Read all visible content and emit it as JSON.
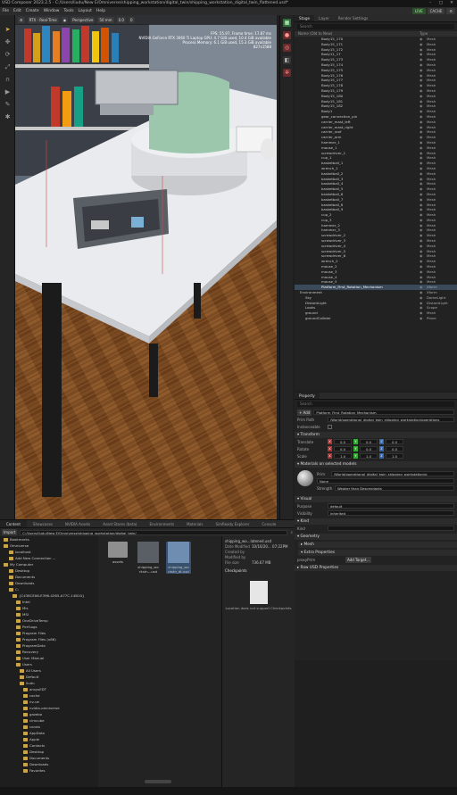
{
  "titlebar": {
    "app": "USD Composer",
    "version": "2023.2.5",
    "path": "C:/Users/liudu/New E/Omniverse/shipping_workstation/digital_twin/shipping_workstation_digital_twin_flattened.usd*"
  },
  "menu": [
    "File",
    "Edit",
    "Create",
    "Window",
    "Tools",
    "Layout",
    "Help"
  ],
  "menu_right": {
    "live": "LIVE",
    "cache": "CACHE"
  },
  "viewport": {
    "render_mode": "RTX - Real-Time",
    "camera": "Perspective",
    "lens": "50 mm",
    "speed": "0.0",
    "lights": "0",
    "stats": [
      "FPS: 55.97, Frame time: 17.87 ms",
      "NVIDIA GeForce RTX 3060 Ti Laptop GPU: 4.7 GiB used, 10.4 GiB available",
      "Process Memory: 6.1 GiB used, 15.3 GiB available",
      "827x1588"
    ]
  },
  "stage": {
    "tabs": [
      "Stage",
      "Layer",
      "Render Settings"
    ],
    "search_placeholder": "Search",
    "col_name": "Name (Old to New)",
    "col_type": "Type",
    "rows": [
      {
        "name": "Body15_170",
        "type": "Mesh"
      },
      {
        "name": "Body15_171",
        "type": "Mesh"
      },
      {
        "name": "Body15_172",
        "type": "Mesh"
      },
      {
        "name": "Body11_17",
        "type": "Mesh"
      },
      {
        "name": "Body15_173",
        "type": "Mesh"
      },
      {
        "name": "Body15_174",
        "type": "Mesh"
      },
      {
        "name": "Body15_175",
        "type": "Mesh"
      },
      {
        "name": "Body15_176",
        "type": "Mesh"
      },
      {
        "name": "Body15_177",
        "type": "Mesh"
      },
      {
        "name": "Body15_178",
        "type": "Mesh"
      },
      {
        "name": "Body15_179",
        "type": "Mesh"
      },
      {
        "name": "Body15_180",
        "type": "Mesh"
      },
      {
        "name": "Body15_181",
        "type": "Mesh"
      },
      {
        "name": "Body15_182",
        "type": "Mesh"
      },
      {
        "name": "Body1",
        "type": "Mesh"
      },
      {
        "name": "gear_connection_pin",
        "type": "Mesh"
      },
      {
        "name": "carrier_mast_left",
        "type": "Mesh"
      },
      {
        "name": "carrier_mast_right",
        "type": "Mesh"
      },
      {
        "name": "carrier_roof",
        "type": "Mesh"
      },
      {
        "name": "carrier_arm",
        "type": "Mesh"
      },
      {
        "name": "hammer_1",
        "type": "Mesh"
      },
      {
        "name": "mouse_1",
        "type": "Mesh"
      },
      {
        "name": "screwdriver_1",
        "type": "Mesh"
      },
      {
        "name": "cup_1",
        "type": "Mesh"
      },
      {
        "name": "basketball_1",
        "type": "Mesh"
      },
      {
        "name": "wrench_1",
        "type": "Mesh"
      },
      {
        "name": "basketball_2",
        "type": "Mesh"
      },
      {
        "name": "basketball_3",
        "type": "Mesh"
      },
      {
        "name": "basketball_4",
        "type": "Mesh"
      },
      {
        "name": "basketball_5",
        "type": "Mesh"
      },
      {
        "name": "basketball_6",
        "type": "Mesh"
      },
      {
        "name": "basketball_7",
        "type": "Mesh"
      },
      {
        "name": "basketball_8",
        "type": "Mesh"
      },
      {
        "name": "basketball_9",
        "type": "Mesh"
      },
      {
        "name": "cup_2",
        "type": "Mesh"
      },
      {
        "name": "cup_3",
        "type": "Mesh"
      },
      {
        "name": "hammer_2",
        "type": "Mesh"
      },
      {
        "name": "hammer_3",
        "type": "Mesh"
      },
      {
        "name": "screwdriver_2",
        "type": "Mesh"
      },
      {
        "name": "screwdriver_3",
        "type": "Mesh"
      },
      {
        "name": "screwdriver_4",
        "type": "Mesh"
      },
      {
        "name": "screwdriver_5",
        "type": "Mesh"
      },
      {
        "name": "screwdriver_6",
        "type": "Mesh"
      },
      {
        "name": "wrench_2",
        "type": "Mesh"
      },
      {
        "name": "mouse_2",
        "type": "Mesh"
      },
      {
        "name": "mouse_3",
        "type": "Mesh"
      },
      {
        "name": "mouse_4",
        "type": "Mesh"
      },
      {
        "name": "mouse_5",
        "type": "Mesh"
      },
      {
        "name": "Platform_First_Rotation_Mechanism",
        "type": "Xform",
        "selected": true
      },
      {
        "name": "Environment",
        "type": "Xform"
      },
      {
        "name": "Sky",
        "type": "DomeLight"
      },
      {
        "name": "DistantLight",
        "type": "DistantLight"
      },
      {
        "name": "Looks",
        "type": "Scope"
      },
      {
        "name": "ground",
        "type": "Mesh"
      },
      {
        "name": "groundCollider",
        "type": "Plane"
      }
    ]
  },
  "property": {
    "title": "Property",
    "search_placeholder": "Search",
    "add_label": "Add",
    "prim_name": "Platform_First_Rotation_Mechanism",
    "prim_path_label": "Prim Path",
    "prim_path": "/World/operational_digital_twin_shipping_workstation/operations",
    "instanceable_label": "Instanceable",
    "transform_label": "Transform",
    "translate_label": "Translate",
    "rotate_label": "Rotate",
    "scale_label": "Scale",
    "translate": [
      "0.0",
      "0.0",
      "0.0"
    ],
    "rotate": [
      "0.0",
      "0.0",
      "0.0"
    ],
    "scale": [
      "1.0",
      "1.0",
      "1.0"
    ],
    "materials_label": "Materials on selected models",
    "prim_label": "Prim",
    "material_path": "/World/operational_digital_twin_shipping_workstation/o",
    "material_value": "None",
    "strength_label": "Strength",
    "strength_value": "Weaker than Descendants",
    "visual_label": "Visual",
    "purpose_label": "Purpose",
    "purpose_value": "default",
    "visibility_label": "Visibility",
    "visibility_value": "inherited",
    "kind_label": "Kind",
    "kind_field_label": "Kind",
    "geometry_label": "Geometry",
    "mesh_label": "Mesh",
    "extra_label": "Extra Properties",
    "proxy_label": "proxyPrim",
    "add_target": "Add Target...",
    "raw_label": "Raw USD Properties"
  },
  "bottom": {
    "tabs": [
      "Content",
      "Showcases",
      "NVIDIA Assets",
      "Asset Stores (beta)",
      "Environments",
      "Materials",
      "SimReady Explorer",
      "Console"
    ],
    "import_label": "Import",
    "path": "C:/Users/liudu/New E/Omniverse/shipping_workstation/digital_twin/",
    "tree": [
      "Bookmarks",
      "Omniverse",
      "localhost",
      "Add New Connection ...",
      "My Computer",
      "Desktop",
      "Documents",
      "Downloads",
      "C:",
      "{C438CE06-E396-4265-A77C-14B10}",
      "Intel",
      "Mls",
      "MSI",
      "OneDriveTemp",
      "PerfLogs",
      "Program Files",
      "Program Files (x86)",
      "ProgramData",
      "Recovery",
      "User Manual",
      "Users",
      "All Users",
      "Default",
      "liudu",
      "ansysEDT",
      "cache",
      "nv-ue",
      "nvidia-omniverse",
      "gazebo",
      "cimcube",
      "conda",
      "AppData",
      "Apple",
      "Contacts",
      "Desktop",
      "Documents",
      "Downloads",
      "Favorites"
    ],
    "files": [
      "assets",
      "shipping_wo rkstn...usd",
      "shipping_wo rkstn_dt.usd"
    ],
    "info": {
      "name": "shipping_wo...latened.usd",
      "modified_label": "Date Modified",
      "modified": "10/16/20... 07:22PM",
      "created_label": "Created by",
      "modified_by_label": "Modified by",
      "size_label": "File size",
      "size": "736.67 MB",
      "checkpoints": "Checkpoints",
      "no_checkpoints": "Location does not support Checkpoints"
    }
  }
}
